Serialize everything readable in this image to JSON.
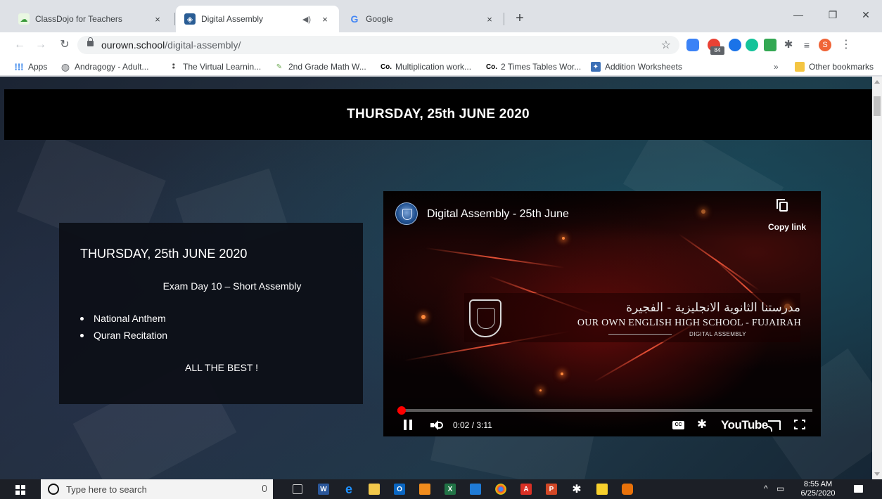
{
  "browser": {
    "tabs": [
      {
        "title": "ClassDojo for Teachers",
        "active": false
      },
      {
        "title": "Digital Assembly",
        "active": true,
        "audio": true
      },
      {
        "title": "Google",
        "active": false
      }
    ],
    "close_glyph": "×",
    "new_tab_glyph": "+",
    "url_host": "ourown.school",
    "url_path": "/digital-assembly/",
    "extension_badge": "84",
    "profile_initial": "S",
    "bookmarks": [
      {
        "label": "Apps",
        "icon": "apps-grid-icon"
      },
      {
        "label": "Andragogy - Adult...",
        "icon": "globe-icon"
      },
      {
        "label": "The Virtual Learnin...",
        "icon": "virtual-learning-icon"
      },
      {
        "label": "2nd Grade Math W...",
        "icon": "math-icon"
      },
      {
        "label": "Multiplication work...",
        "icon": "co-icon"
      },
      {
        "label": "2 Times Tables Wor...",
        "icon": "co-icon"
      },
      {
        "label": "Addition Worksheets",
        "icon": "worksheet-icon"
      }
    ],
    "more_bookmarks": "»",
    "other_bookmarks": "Other bookmarks"
  },
  "page": {
    "banner_title": "THURSDAY, 25th JUNE 2020",
    "info": {
      "title": "THURSDAY, 25th JUNE 2020",
      "subtitle": "Exam Day 10 – Short Assembly",
      "items": [
        "National Anthem",
        "Quran Recitation"
      ],
      "footer": "ALL THE BEST !"
    }
  },
  "video": {
    "title": "Digital Assembly - 25th June",
    "copy_link": "Copy link",
    "arabic_name": "مدرستنا الثانوية الانجليزية - الفجيرة",
    "school_name": "OUR OWN ENGLISH HIGH SCHOOL - FUJAIRAH",
    "overlay_tag": "DIGITAL ASSEMBLY",
    "current_time": "0:02",
    "duration": "3:11",
    "time_display": "0:02 / 3:11",
    "progress_fraction": 0.0105,
    "cc_label": "CC",
    "youtube_label": "YouTube"
  },
  "taskbar": {
    "search_placeholder": "Type here to search",
    "clock_time": "8:55 AM",
    "clock_date": "6/25/2020"
  },
  "colors": {
    "accent_red": "#ff0000",
    "banner_bg": "#000000",
    "chrome_frame": "#dee1e6"
  }
}
